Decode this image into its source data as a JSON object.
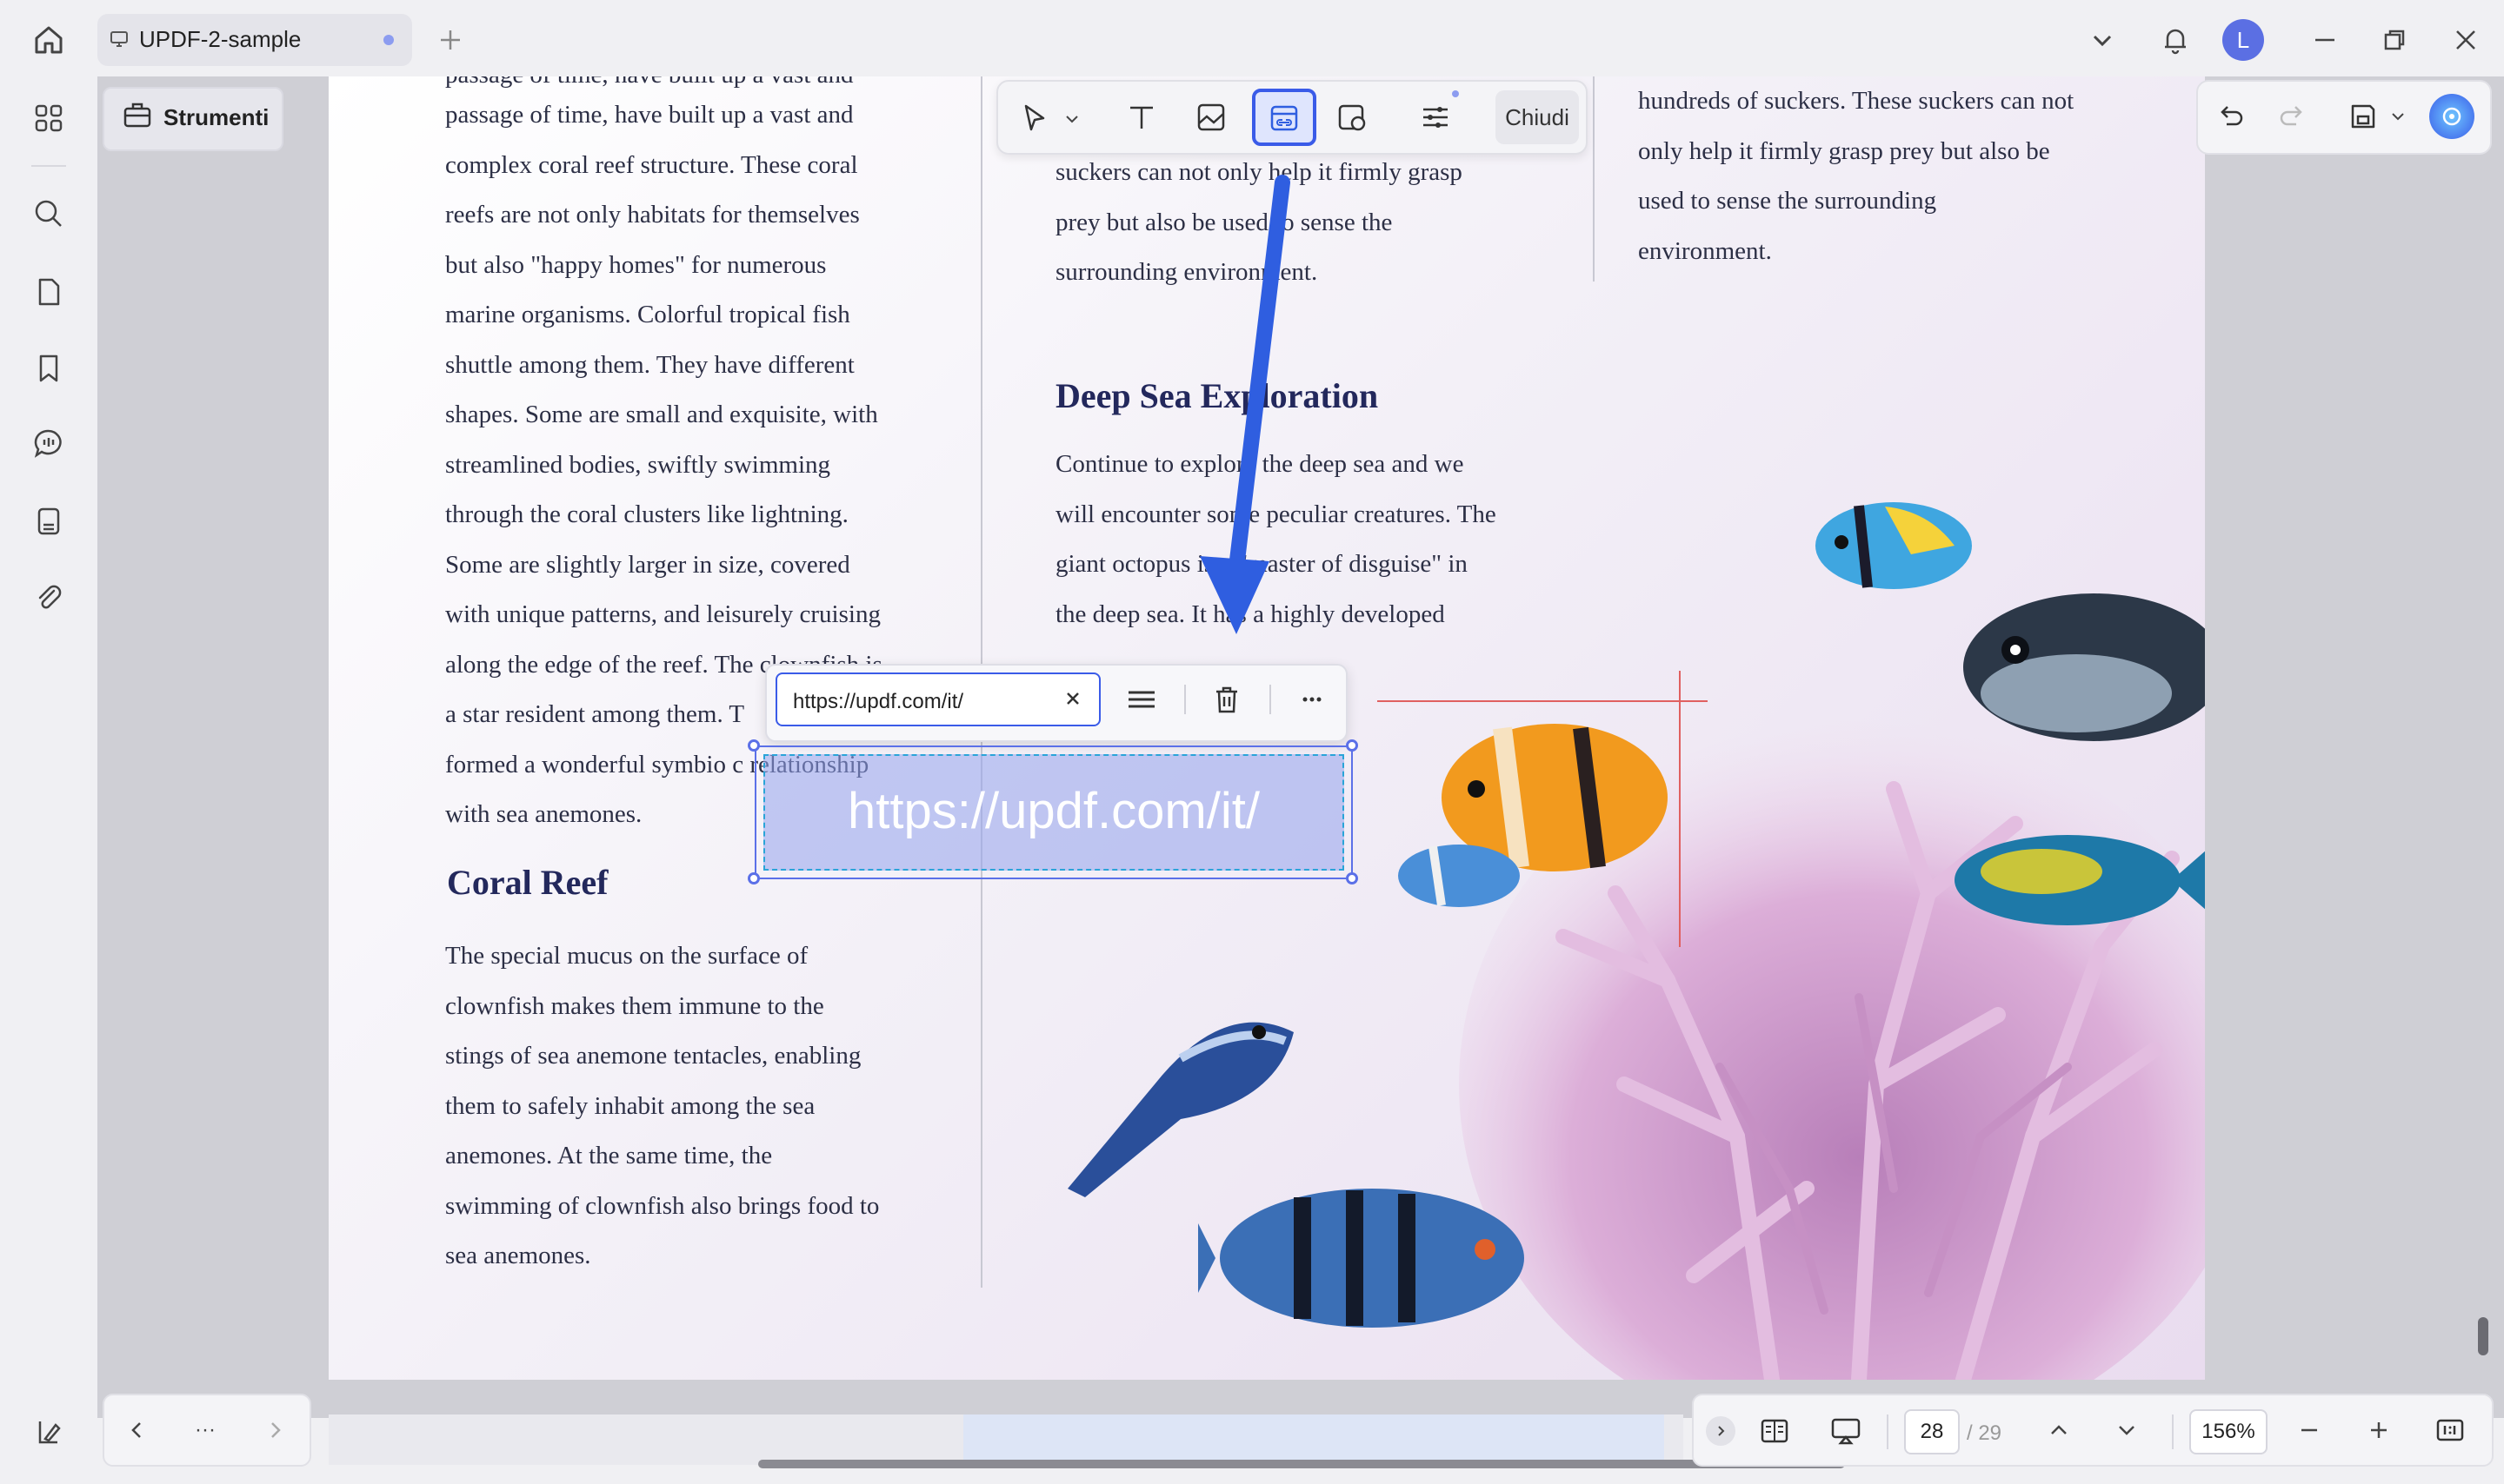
{
  "titlebar": {
    "tab_title": "UPDF-2-sample",
    "avatar_initial": "L"
  },
  "toolbar": {
    "strumenti_label": "Strumenti",
    "chiudi_label": "Chiudi"
  },
  "document": {
    "col1_text": "passage of time, have built up a vast and\ncomplex coral reef structure. These coral\nreefs are not only habitats for themselves\nbut also \"happy homes\" for numerous\nmarine organisms. Colorful tropical fish\nshuttle among them. They have different\nshapes. Some are small and exquisite, with\nstreamlined bodies, swiftly swimming\nthrough the coral clusters like lightning.\nSome are slightly larger in size, covered\nwith unique patterns, and leisurely cruising\nalong the edge of the reef. The clownfish is\na star resident among them. T\nformed a wonderful symbio c relationship\nwith sea anemones.",
    "coral_heading": "Coral Reef",
    "coral_text": " The special mucus on the surface of\nclownfish makes them immune to the\nstings of sea anemone tentacles, enabling\nthem to safely inhabit among the sea\nanemones. At the same time, the\nswimming of clownfish also brings food to\nsea anemones.",
    "col2_top_text": "suckers can not only help it firmly grasp\nprey but also be used to sense the\nsurrounding environment.",
    "deep_heading": "Deep Sea Exploration",
    "deep_text": "Continue to explore the deep sea and we\nwill encounter some peculiar creatures. The\ngiant octopus is a \"master of disguise\" in\nthe deep sea. It has a highly developed",
    "col3_text": "hundreds of suckers. These suckers can not\nonly help it firmly grasp prey but also be\nused to sense the surrounding\nenvironment."
  },
  "link": {
    "url_input": "https://updf.com/it/",
    "url_display": "https://updf.com/it/"
  },
  "pagination": {
    "current_page": "28",
    "total_pages": "/ 29",
    "zoom": "156%",
    "more_label": "···"
  },
  "colors": {
    "accent": "#3a5be8",
    "heading": "#23285c",
    "link_fill": "#94a2ec"
  }
}
